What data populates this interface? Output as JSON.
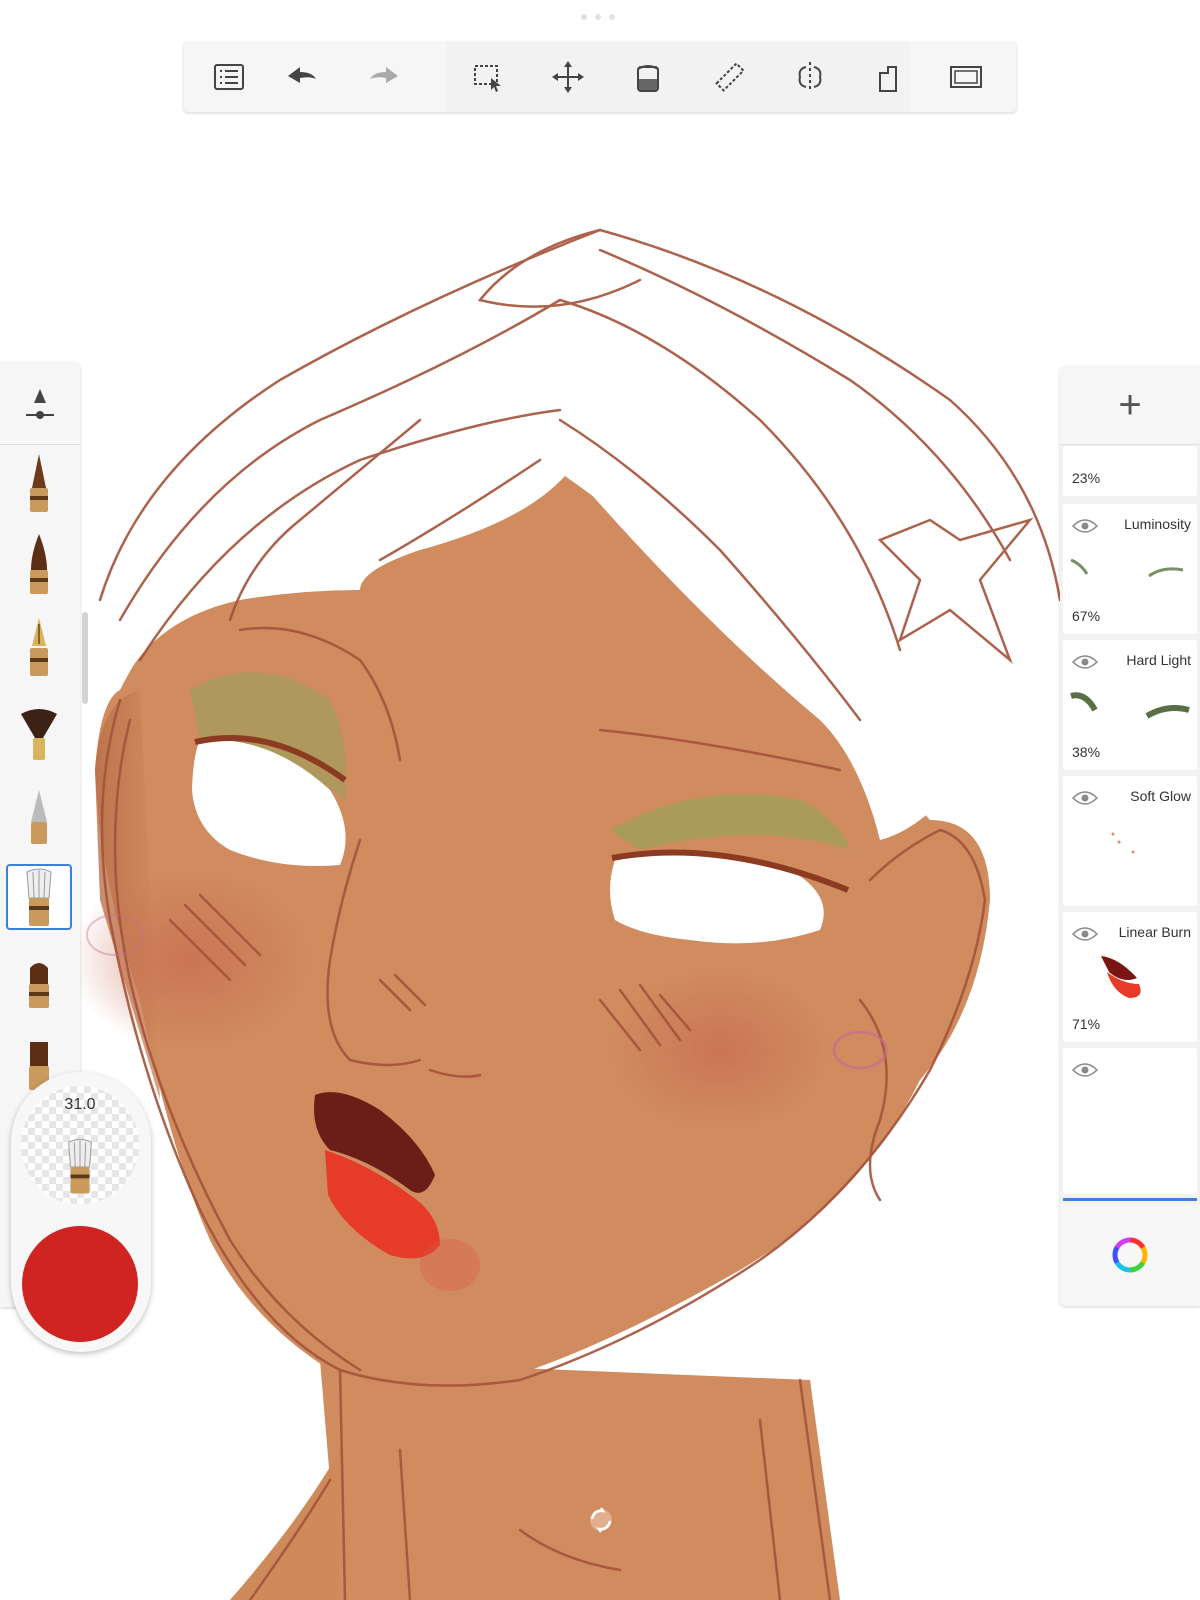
{
  "toolbar": {
    "items": [
      "list-icon",
      "undo-icon",
      "redo-icon",
      "selection-icon",
      "transform-icon",
      "fill-bucket-icon",
      "ruler-icon",
      "symmetry-icon",
      "perspective-icon",
      "fullscreen-icon"
    ]
  },
  "brushes": {
    "items": [
      "pencil-brush",
      "marker-brush",
      "pen-brush",
      "fan-brush",
      "airbrush-brush",
      "soft-brush",
      "blender-brush",
      "paint-brush"
    ],
    "selected": "soft-brush"
  },
  "brush_puck": {
    "size_value": "31.0",
    "current_color": "#cf2421"
  },
  "layers": {
    "add_label": "+",
    "items": [
      {
        "blend": "",
        "opacity": "23%"
      },
      {
        "blend": "Luminosity",
        "opacity": "67%"
      },
      {
        "blend": "Hard Light",
        "opacity": "38%"
      },
      {
        "blend": "Soft Glow",
        "opacity": ""
      },
      {
        "blend": "Linear Burn",
        "opacity": "71%"
      },
      {
        "blend": "",
        "opacity": ""
      }
    ]
  },
  "colors": {
    "skin": "#d08b5e",
    "sketch": "#a4533a",
    "lip": "#e53b28",
    "accent": "#3b7fe0"
  }
}
